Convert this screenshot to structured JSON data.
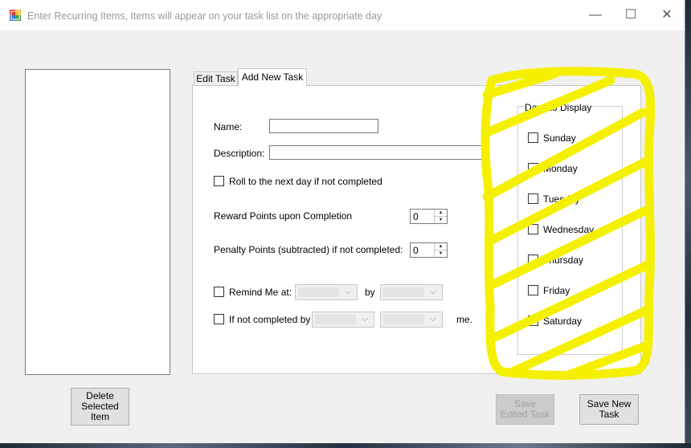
{
  "window": {
    "title": "Enter Recurring Items, Items will appear on your task list on the appropriate day",
    "minimize_glyph": "—",
    "maximize_glyph": "☐",
    "close_glyph": "✕"
  },
  "left": {
    "delete_button": "Delete Selected Item"
  },
  "tabs": [
    {
      "label": "Edit Task",
      "active": false
    },
    {
      "label": "Add New Task",
      "active": true
    }
  ],
  "form": {
    "name_label": "Name:",
    "name_value": "",
    "description_label": "Description:",
    "description_value": "",
    "roll_label": "Roll to the next day if not completed",
    "reward_label": "Reward Points upon Completion",
    "reward_value": "0",
    "penalty_label": "Penalty Points (subtracted) if not completed:",
    "penalty_value": "0",
    "remind_label": "Remind Me at:",
    "by_label": "by",
    "notcompleted_label": "If not completed by",
    "me_label": "me."
  },
  "days": {
    "group_title": "Days to Display",
    "items": [
      "Sunday",
      "Monday",
      "Tuesday",
      "Wednesday",
      "Thursday",
      "Friday",
      "Saturday"
    ]
  },
  "buttons": {
    "save_edited": "Save Edited Task",
    "save_new": "Save New Task"
  },
  "colors": {
    "highlight": "#f5f000",
    "window_bg": "#f0f0f0",
    "disabled_text": "#a0a0a0"
  },
  "icons": {
    "app": "app-icon",
    "spin_up": "chevron-up-icon",
    "spin_down": "chevron-down-icon",
    "combo": "chevron-down-icon"
  }
}
